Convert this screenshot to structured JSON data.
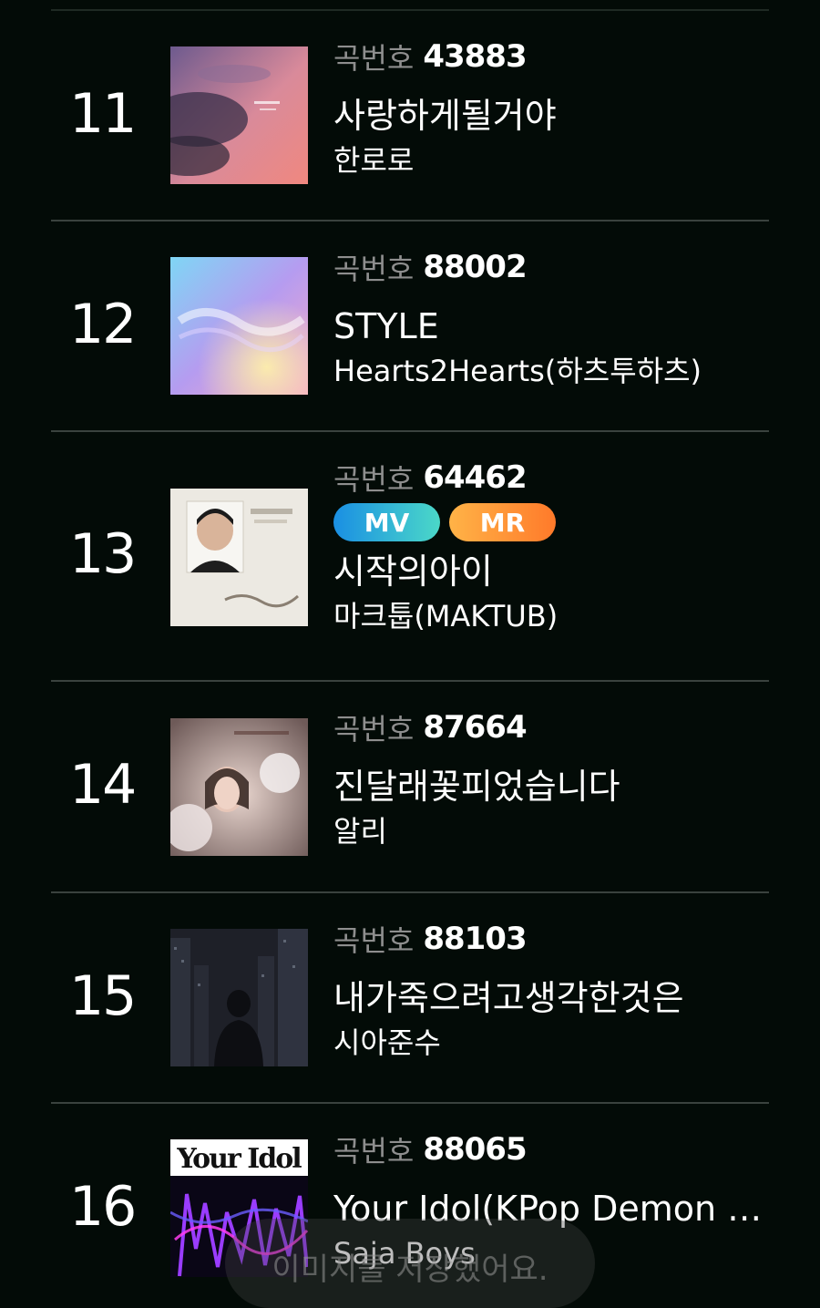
{
  "chart": {
    "songs": [
      {
        "rank": "11",
        "number_label": "곡번호",
        "number": "43883",
        "title": "사랑하게될거야",
        "artist": "한로로",
        "cover": "cloud-sky-album-cover"
      },
      {
        "rank": "12",
        "number_label": "곡번호",
        "number": "88002",
        "title": "STYLE",
        "artist": "Hearts2Hearts(하츠투하츠)",
        "cover": "holographic-style-album-cover"
      },
      {
        "rank": "13",
        "number_label": "곡번호",
        "number": "64462",
        "badges": [
          "MV",
          "MR"
        ],
        "title": "시작의아이",
        "artist": "마크툽(MAKTUB)",
        "cover": "child-portrait-album-cover"
      },
      {
        "rank": "14",
        "number_label": "곡번호",
        "number": "87664",
        "title": "진달래꽃피었습니다",
        "artist": "알리",
        "cover": "woman-flowers-album-cover"
      },
      {
        "rank": "15",
        "number_label": "곡번호",
        "number": "88103",
        "title": "내가죽으려고생각한것은",
        "artist": "시아준수",
        "cover": "night-city-album-cover"
      },
      {
        "rank": "16",
        "number_label": "곡번호",
        "number": "88065",
        "title": "Your Idol(KPop Demon H...",
        "artist": "Saja Boys",
        "cover": "your-idol-album-cover",
        "cover_text": "Your Idol"
      }
    ]
  },
  "toast": {
    "text": "이미지를 저장했어요."
  },
  "colors": {
    "background": "#030b07",
    "divider": "#3a423e",
    "label_gray": "#8e8e8e",
    "mv_badge": "#1a8fe3",
    "mr_badge": "#ff8c2a"
  }
}
